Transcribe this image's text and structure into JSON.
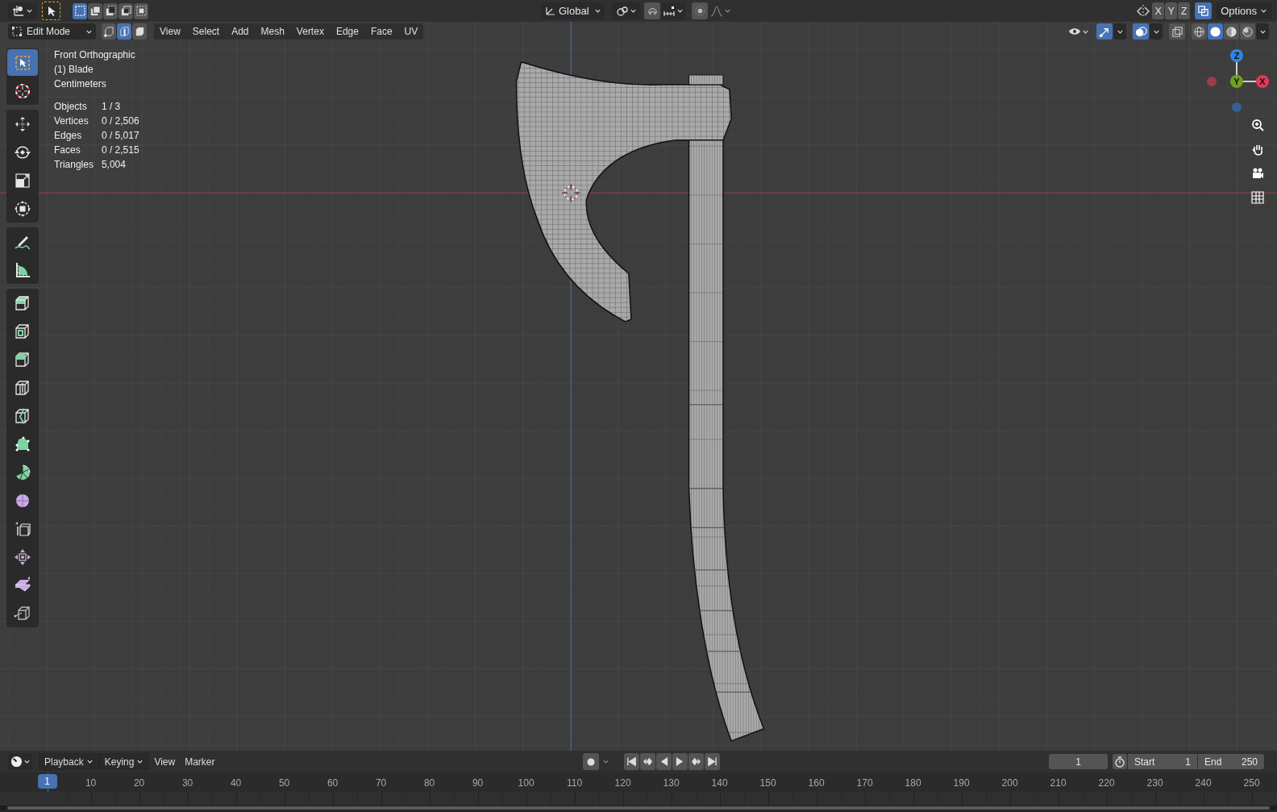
{
  "top_bar": {
    "select_tool": {
      "selected": true
    },
    "select_modes": [
      {
        "kind": "set",
        "selected": true
      },
      {
        "kind": "extend",
        "selected": false
      },
      {
        "kind": "subtract",
        "selected": false
      },
      {
        "kind": "difference",
        "selected": false
      },
      {
        "kind": "intersect",
        "selected": false
      }
    ],
    "orientation": "Global",
    "mirror_axes": [
      "X",
      "Y",
      "Z"
    ],
    "auto_merge": {
      "on": true
    },
    "options": "Options"
  },
  "header": {
    "mode": "Edit Mode",
    "element_modes": [
      {
        "kind": "vertex",
        "selected": false
      },
      {
        "kind": "edge",
        "selected": true
      },
      {
        "kind": "face",
        "selected": false
      }
    ],
    "menus": [
      "View",
      "Select",
      "Add",
      "Mesh",
      "Vertex",
      "Edge",
      "Face",
      "UV"
    ],
    "gizmos": {
      "on": true
    },
    "overlays": {
      "on": true
    },
    "xray": {
      "on": false
    },
    "shading_modes": [
      {
        "kind": "wireframe",
        "selected": false
      },
      {
        "kind": "solid",
        "selected": true
      },
      {
        "kind": "material",
        "selected": false
      },
      {
        "kind": "rendered",
        "selected": false
      }
    ]
  },
  "viewport_info": {
    "view": "Front Orthographic",
    "object": "(1) Blade",
    "units": "Centimeters",
    "stats": [
      {
        "label": "Objects",
        "value": "1 / 3"
      },
      {
        "label": "Vertices",
        "value": "0 / 2,506"
      },
      {
        "label": "Edges",
        "value": "0 / 5,017"
      },
      {
        "label": "Faces",
        "value": "0 / 2,515"
      },
      {
        "label": "Triangles",
        "value": "5,004"
      }
    ]
  },
  "gizmo_axes": [
    "Z",
    "Y",
    "X"
  ],
  "toolbar": [
    {
      "kind": "select_box",
      "selected": true
    },
    {
      "kind": "cursor",
      "selected": false
    },
    {
      "kind": "move",
      "selected": false
    },
    {
      "kind": "rotate",
      "selected": false
    },
    {
      "kind": "scale",
      "selected": false
    },
    {
      "kind": "transform",
      "selected": false
    },
    {
      "kind": "annotate",
      "selected": false
    },
    {
      "kind": "measure",
      "selected": false
    },
    {
      "kind": "extrude",
      "selected": false
    },
    {
      "kind": "inset",
      "selected": false
    },
    {
      "kind": "bevel",
      "selected": false
    },
    {
      "kind": "loop_cut",
      "selected": false
    },
    {
      "kind": "knife",
      "selected": false
    },
    {
      "kind": "poly_build",
      "selected": false
    },
    {
      "kind": "spin",
      "selected": false
    },
    {
      "kind": "smooth",
      "selected": false
    },
    {
      "kind": "edge_slide",
      "selected": false
    },
    {
      "kind": "shrink",
      "selected": false
    },
    {
      "kind": "shear",
      "selected": false
    },
    {
      "kind": "rip",
      "selected": false
    }
  ],
  "timeline": {
    "menus": [
      {
        "label": "Playback",
        "dropdown": true
      },
      {
        "label": "Keying",
        "dropdown": true
      },
      {
        "label": "View",
        "dropdown": false
      },
      {
        "label": "Marker",
        "dropdown": false
      }
    ],
    "current_frame": "1",
    "start_label": "Start",
    "start": "1",
    "end_label": "End",
    "end": "250",
    "playhead": "1",
    "ruler": [
      "10",
      "20",
      "30",
      "40",
      "50",
      "60",
      "70",
      "80",
      "90",
      "100",
      "110",
      "120",
      "130",
      "140",
      "150",
      "160",
      "170",
      "180",
      "190",
      "200",
      "210",
      "220",
      "230",
      "240",
      "250"
    ]
  }
}
